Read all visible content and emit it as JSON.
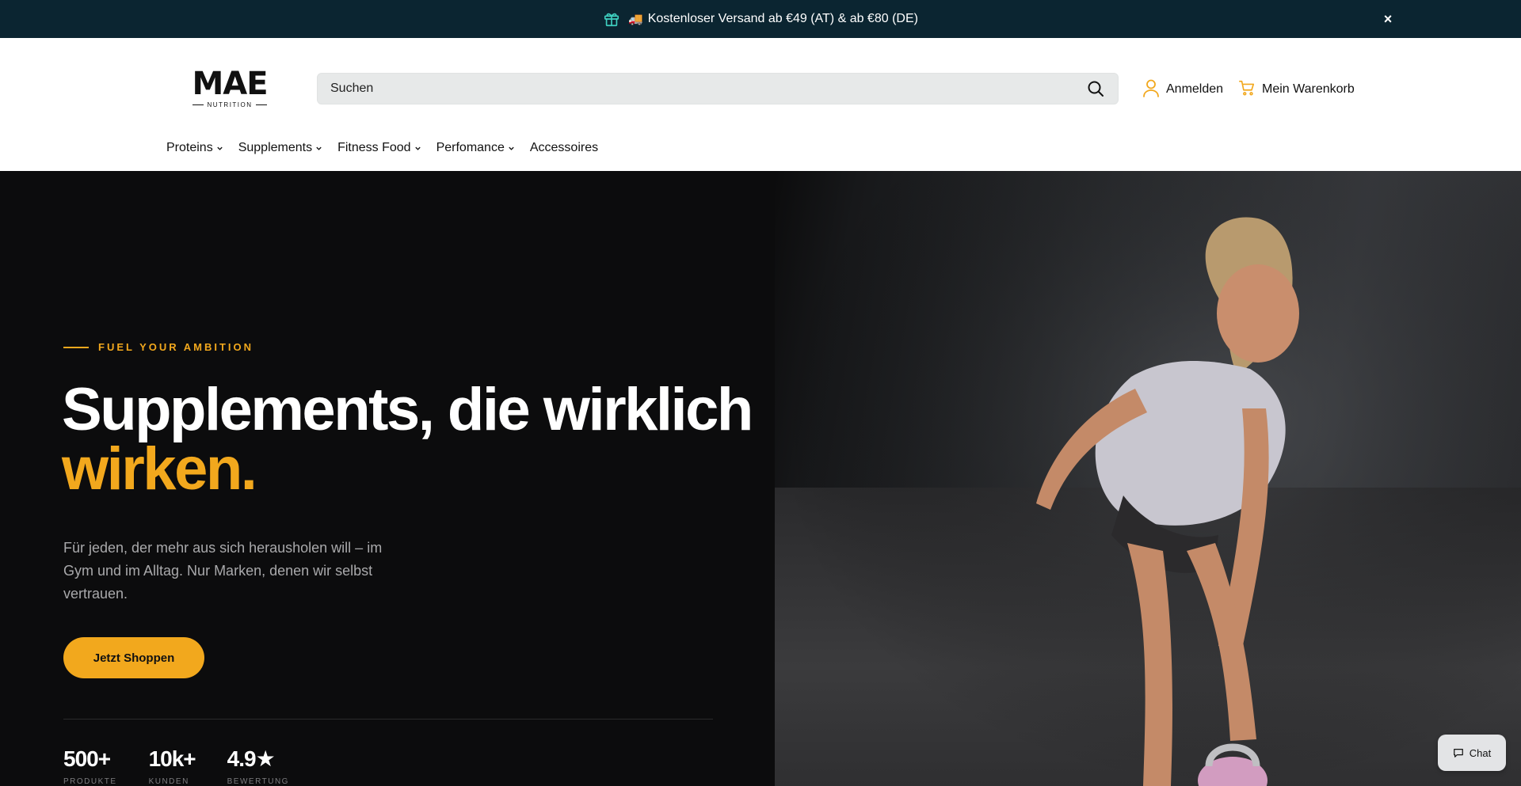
{
  "announcement": {
    "truck_emoji": "🚚",
    "text": "Kostenloser Versand ab €49 (AT) & ab €80 (DE)",
    "close_symbol": "×"
  },
  "header": {
    "logo_word": "MAE",
    "logo_sub": "NUTRITION",
    "search_placeholder": "Suchen",
    "account_label": "Anmelden",
    "cart_label": "Mein Warenkorb",
    "nav": [
      "Proteins",
      "Supplements",
      "Fitness Food",
      "Perfomance",
      "Accessoires"
    ]
  },
  "hero": {
    "eyebrow": "FUEL YOUR AMBITION",
    "headline_line1": "Supplements, die wirklich",
    "headline_accent": "wirken.",
    "lead": "Für jeden, der mehr aus sich herausholen will – im Gym und im Alltag. Nur Marken, denen wir selbst vertrauen.",
    "cta_label": "Jetzt Shoppen",
    "stats": [
      {
        "value": "500+",
        "label": "PRODUKTE"
      },
      {
        "value": "10k+",
        "label": "KUNDEN"
      },
      {
        "value": "4.9★",
        "label": "BEWERTUNG"
      }
    ]
  },
  "chat": {
    "label": "Chat"
  },
  "colors": {
    "accent": "#f2a81d",
    "announcement_bg": "#0b2531",
    "hero_bg": "#0c0c0d",
    "gift_icon": "#3fd0c0"
  }
}
